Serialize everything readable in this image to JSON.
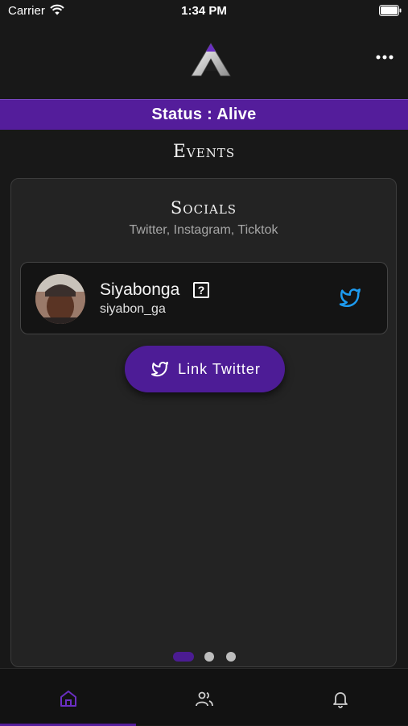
{
  "status_bar": {
    "carrier": "Carrier",
    "time": "1:34 PM",
    "icons": [
      "wifi-icon",
      "battery-icon"
    ]
  },
  "header": {
    "logo_icon": "app-logo-icon",
    "menu_icon": "more-horizontal-icon"
  },
  "status_banner": {
    "text": "Status : Alive",
    "color": "#541d9b"
  },
  "events": {
    "title": "Events"
  },
  "socials": {
    "title": "Socials",
    "subtitle": "Twitter, Instagram, Ticktok",
    "profile": {
      "name": "Siyabonga",
      "help_glyph": "?",
      "handle": "siyabon_ga",
      "network_icon": "twitter-icon"
    },
    "link_button": {
      "label": "Link Twitter",
      "icon": "twitter-icon",
      "color": "#4d1c96"
    }
  },
  "pager": {
    "pages": 3,
    "active_index": 0
  },
  "tab_bar": {
    "tabs": [
      {
        "icon": "home-icon",
        "active": true
      },
      {
        "icon": "people-icon",
        "active": false
      },
      {
        "icon": "bell-icon",
        "active": false
      }
    ],
    "accent": "#541d9b"
  },
  "colors": {
    "background": "#181818",
    "card": "#232323",
    "twitter_blue": "#1d9bf0"
  }
}
